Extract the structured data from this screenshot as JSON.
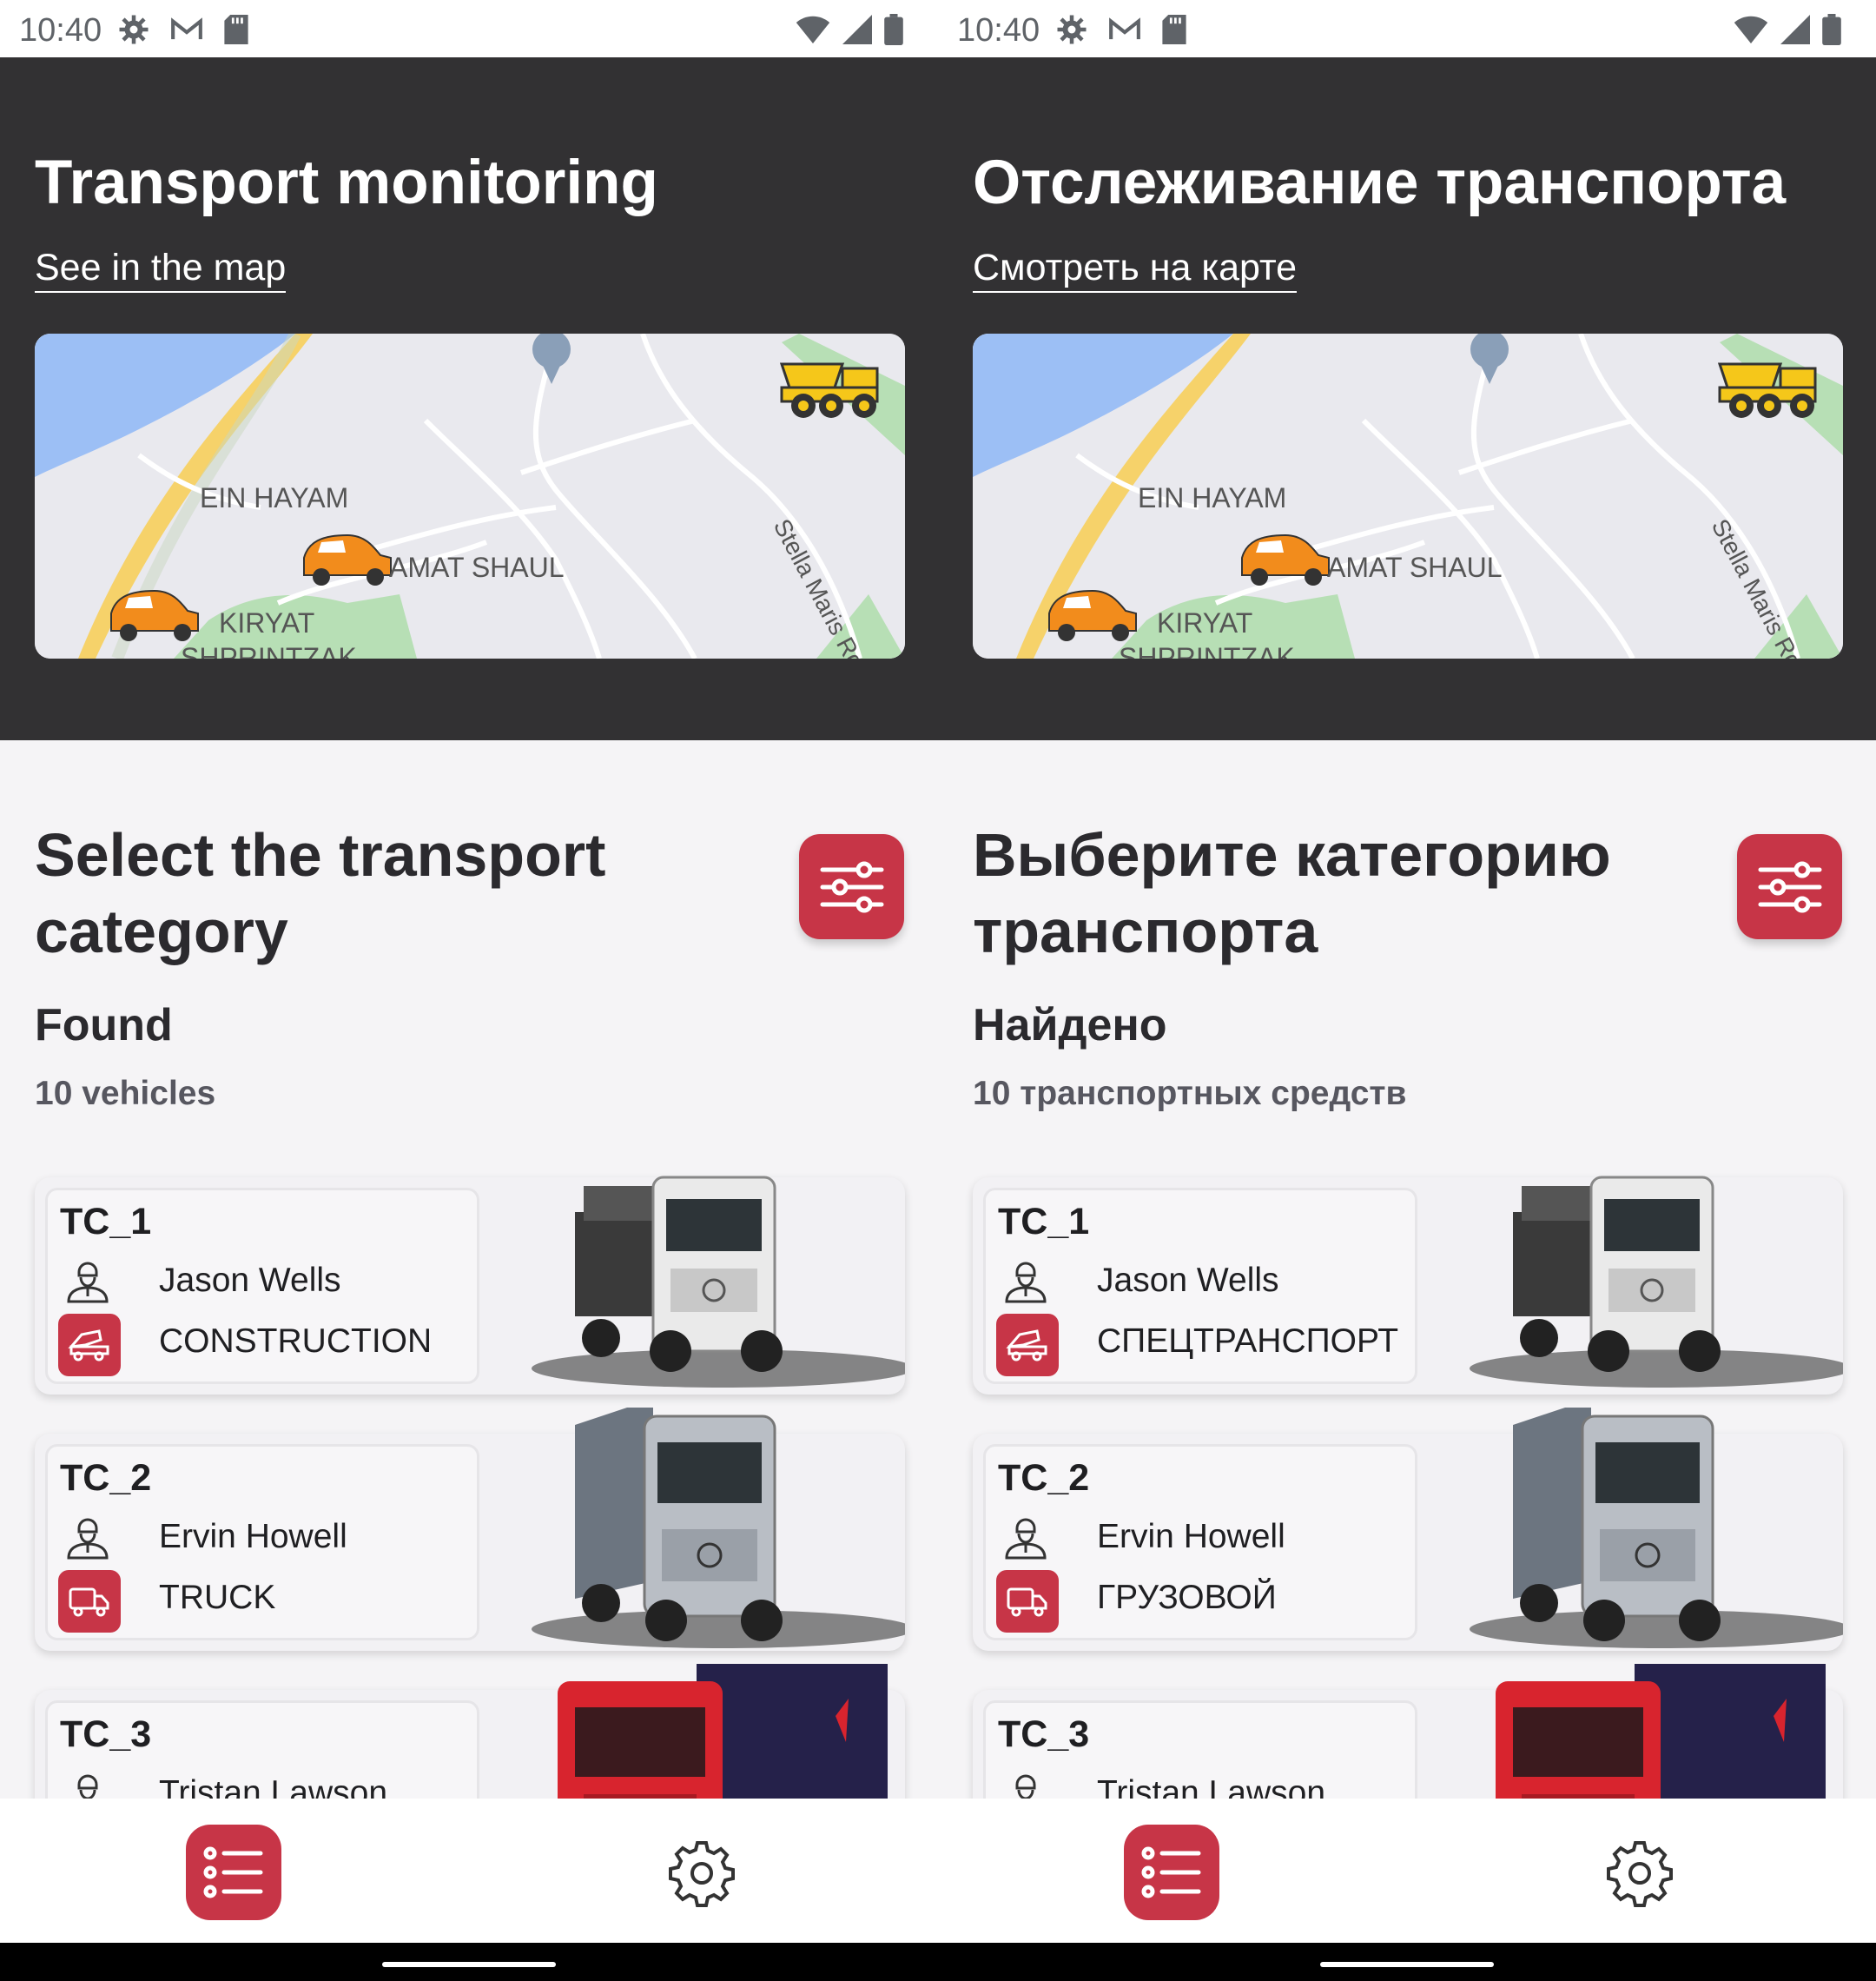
{
  "panels": [
    {
      "lang": "en",
      "status": {
        "time": "10:40"
      },
      "header": {
        "title": "Transport monitoring",
        "map_link": "See in the map"
      },
      "map": {
        "labels": [
          "EIN HAYAM",
          "AMAT SHAUL",
          "KIRYAT",
          "SHPRINTZAK",
          "Stella Maris Rd"
        ]
      },
      "section": {
        "title": "Select the transport category",
        "found_label": "Found",
        "found_count": "10 vehicles"
      },
      "vehicles": [
        {
          "id": "TC_1",
          "driver": "Jason Wells",
          "category": "CONSTRUCTION",
          "category_icon": "construction-truck-icon",
          "truck_color": "#e9e9ea"
        },
        {
          "id": "TC_2",
          "driver": "Ervin Howell",
          "category": "TRUCK",
          "category_icon": "delivery-truck-icon",
          "truck_color": "#bfc3ca"
        },
        {
          "id": "TC_3",
          "driver": "Tristan Lawson",
          "category": "",
          "category_icon": "",
          "truck_color": "#d8242e"
        }
      ],
      "nav": {
        "items": [
          "list-icon",
          "settings-icon"
        ]
      }
    },
    {
      "lang": "ru",
      "status": {
        "time": "10:40"
      },
      "header": {
        "title": "Отслеживание транспорта",
        "map_link": "Смотреть на карте"
      },
      "map": {
        "labels": [
          "EIN HAYAM",
          "AMAT SHAUL",
          "KIRYAT",
          "SHPRINTZAK",
          "Stella Maris Rd"
        ]
      },
      "section": {
        "title": "Выберите категорию транспорта",
        "found_label": "Найдено",
        "found_count": "10 транспортных средств"
      },
      "vehicles": [
        {
          "id": "TC_1",
          "driver": "Jason Wells",
          "category": "СПЕЦТРАНСПОРТ",
          "category_icon": "construction-truck-icon",
          "truck_color": "#e9e9ea"
        },
        {
          "id": "TC_2",
          "driver": "Ervin Howell",
          "category": "ГРУЗОВОЙ",
          "category_icon": "delivery-truck-icon",
          "truck_color": "#bfc3ca"
        },
        {
          "id": "TC_3",
          "driver": "Tristan Lawson",
          "category": "",
          "category_icon": "",
          "truck_color": "#d8242e"
        }
      ],
      "nav": {
        "items": [
          "list-icon",
          "settings-icon"
        ]
      }
    }
  ],
  "colors": {
    "accent": "#c73547",
    "header_bg": "#323133",
    "page_bg": "#f5f4f6"
  }
}
